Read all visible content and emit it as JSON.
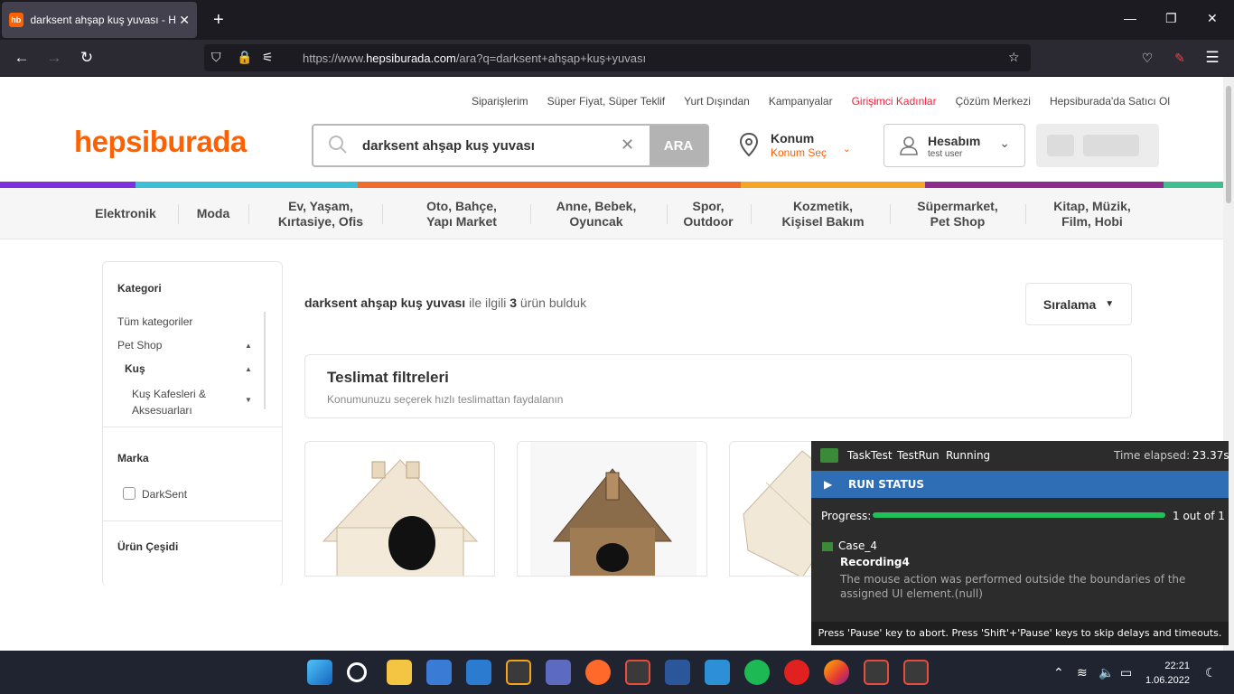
{
  "browser": {
    "tab_title": "darksent ahşap kuş yuvası - Hepsiburada",
    "favicon_text": "hb",
    "url_base": "https://www.",
    "url_domain": "hepsiburada.com",
    "url_path": "/ara?q=darksent+ahşap+kuş+yuvası"
  },
  "header": {
    "top_links": [
      "Siparişlerim",
      "Süper Fiyat, Süper Teklif",
      "Yurt Dışından",
      "Kampanyalar",
      "Girişimci Kadınlar",
      "Çözüm Merkezi",
      "Hepsiburada'da Satıcı Ol"
    ],
    "logo": "hepsiburada",
    "search_value": "darksent ahşap kuş yuvası",
    "search_button": "ARA",
    "location_title": "Konum",
    "location_sub": "Konum Seç",
    "account_title": "Hesabım",
    "account_user": "test user"
  },
  "categories": [
    "Elektronik",
    "Moda",
    "Ev, Yaşam,\nKırtasiye, Ofis",
    "Oto, Bahçe,\nYapı Market",
    "Anne, Bebek,\nOyuncak",
    "Spor,\nOutdoor",
    "Kozmetik,\nKişisel Bakım",
    "Süpermarket,\nPet Shop",
    "Kitap, Müzik,\nFilm, Hobi"
  ],
  "sidebar": {
    "kategori_title": "Kategori",
    "all_categories": "Tüm kategoriler",
    "pet_shop": "Pet Shop",
    "kus": "Kuş",
    "kus_sub": "Kuş Kafesleri &\nAksesuarları",
    "marka_title": "Marka",
    "brand_option": "DarkSent",
    "urun_title": "Ürün Çeşidi"
  },
  "results": {
    "query": "darksent ahşap kuş yuvası",
    "mid_text": " ile ilgili ",
    "count": "3",
    "end_text": " ürün bulduk",
    "sort_label": "Sıralama"
  },
  "delivery": {
    "title": "Teslimat filtreleri",
    "subtitle": "Konumunuzu seçerek hızlı teslimattan faydalanın"
  },
  "overlay": {
    "app": "TaskTest",
    "run": "TestRun",
    "state": "Running",
    "elapsed_label": "Time elapsed:",
    "elapsed_value": "23.37s",
    "run_status": "RUN STATUS",
    "progress_label": "Progress:",
    "progress_fraction": 1.0,
    "progress_text": "1 out of 1",
    "case_name": "Case_4",
    "recording": "Recording4",
    "message": "The mouse action was performed outside the boundaries of the assigned UI element.(null)",
    "footer": "Press 'Pause' key to abort. Press 'Shift'+'Pause' keys to skip delays and timeouts."
  },
  "taskbar": {
    "time": "22:21",
    "date": "1.06.2022"
  },
  "colors": {
    "brand": "#ff6000",
    "stripe": [
      "#7e2fe0",
      "#3bbfd6",
      "#ef6c2e",
      "#f5a623",
      "#8e2b8e",
      "#3fbf8f"
    ]
  }
}
